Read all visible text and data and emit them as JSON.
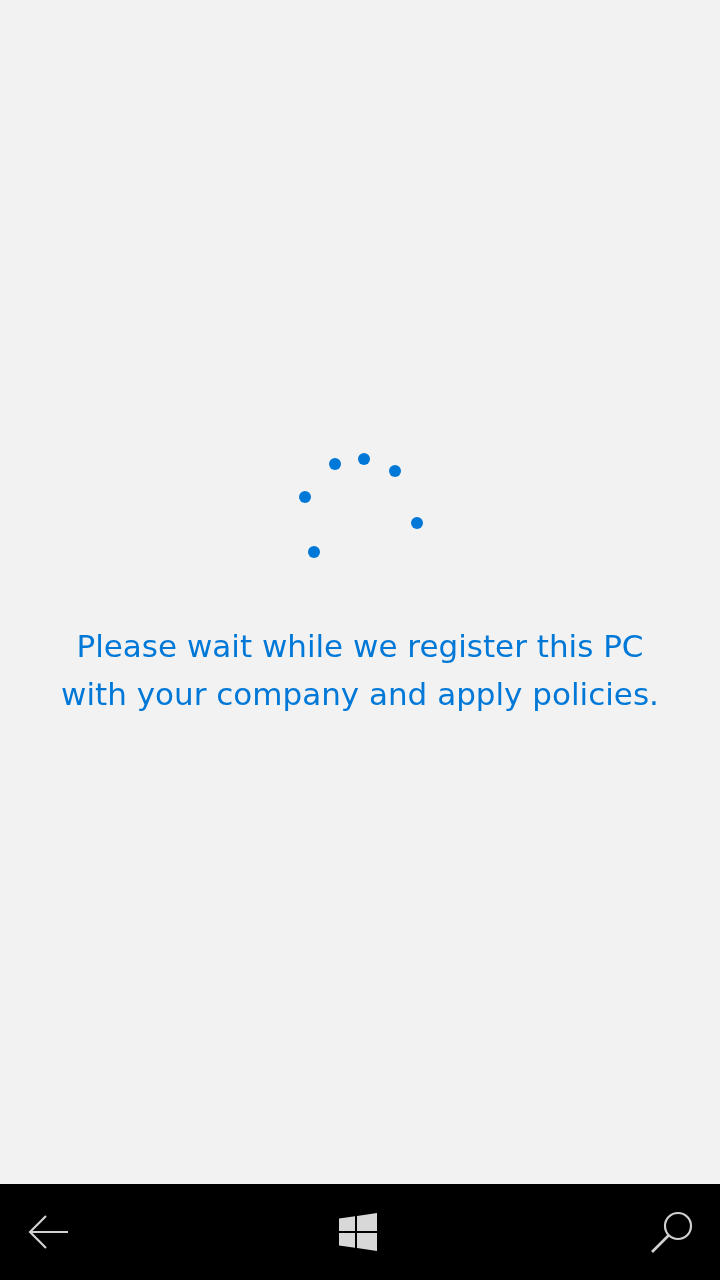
{
  "message": {
    "lines": [
      "Please wait while we register this PC",
      "with your company and apply policies."
    ]
  }
}
